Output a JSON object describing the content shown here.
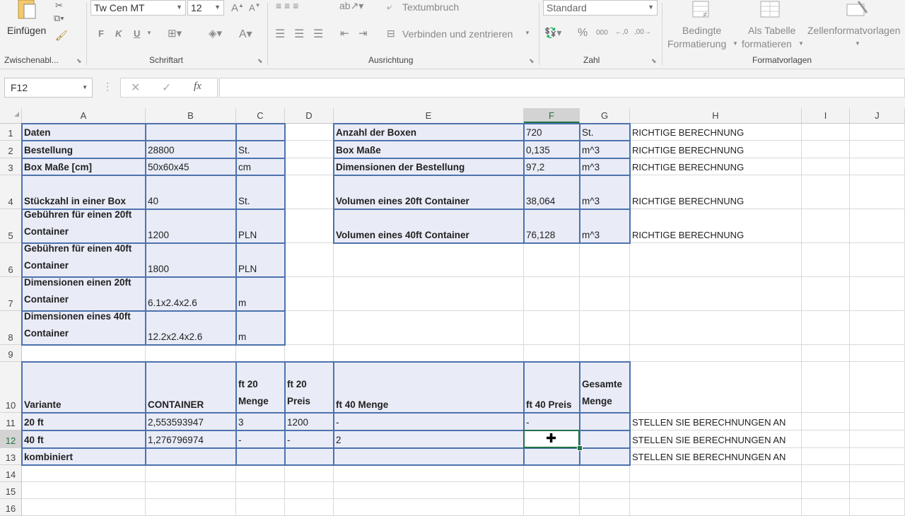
{
  "ribbon": {
    "paste_label": "Einfügen",
    "clipboard_label": "Zwischenabl...",
    "font_name": "Tw Cen MT",
    "font_size": "12",
    "bold": "F",
    "italic": "K",
    "underline": "U",
    "font_group_label": "Schriftart",
    "wrap_text": "Textumbruch",
    "merge_center": "Verbinden und zentrieren",
    "alignment_label": "Ausrichtung",
    "number_format": "Standard",
    "number_label": "Zahl",
    "cond_format_line1": "Bedingte",
    "cond_format_line2": "Formatierung",
    "as_table_line1": "Als Tabelle",
    "as_table_line2": "formatieren",
    "cell_styles": "Zellenformatvorlagen",
    "styles_label": "Formatvorlagen"
  },
  "formula_bar": {
    "name_box": "F12",
    "fx": "fx",
    "value": ""
  },
  "columns": [
    "A",
    "B",
    "C",
    "D",
    "E",
    "F",
    "G",
    "H",
    "I",
    "J"
  ],
  "selected_cell": "F12",
  "rows": [
    "1",
    "2",
    "3",
    "4",
    "5",
    "6",
    "7",
    "8",
    "9",
    "10",
    "11",
    "12",
    "13",
    "14",
    "15",
    "16"
  ],
  "cells": {
    "A1": "Daten",
    "A2": "Bestellung",
    "B2": "28800",
    "C2": "St.",
    "A3": "Box Maße [cm]",
    "B3": "50x60x45",
    "C3": "cm",
    "A4": "Stückzahl in einer Box",
    "B4": "40",
    "C4": "St.",
    "A5": "Gebühren für einen 20ft Container",
    "B5": "1200",
    "C5": "PLN",
    "A6": "Gebühren für einen 40ft Container",
    "B6": "1800",
    "C6": "PLN",
    "A7": "Dimensionen einen 20ft Container",
    "B7": "6.1x2.4x2.6",
    "C7": "m",
    "A8": "Dimensionen eines 40ft Container",
    "B8": "12.2x2.4x2.6",
    "C8": "m",
    "E1": "Anzahl der Boxen",
    "F1": "720",
    "G1": "St.",
    "H1": "RICHTIGE BERECHNUNG",
    "E2": "Box Maße",
    "F2": "0,135",
    "G2": "m^3",
    "H2": "RICHTIGE BERECHNUNG",
    "E3": "Dimensionen der Bestellung",
    "F3": "97,2",
    "G3": "m^3",
    "H3": "RICHTIGE BERECHNUNG",
    "E4": "Volumen eines 20ft Container",
    "F4": "38,064",
    "G4": "m^3",
    "H4": "RICHTIGE BERECHNUNG",
    "E5": "Volumen eines 40ft Container",
    "F5": "76,128",
    "G5": "m^3",
    "H5": "RICHTIGE BERECHNUNG",
    "A10": "Variante",
    "B10": "CONTAINER",
    "C10": "ft 20 Menge",
    "D10": "ft 20 Preis",
    "E10": "ft 40 Menge",
    "F10": "ft 40 Preis",
    "G10": "Gesamte Menge",
    "A11": "20 ft",
    "B11": "2,553593947",
    "C11": "3",
    "D11": "1200",
    "E11": "-",
    "F11": "-",
    "H11": "STELLEN SIE BERECHNUNGEN AN",
    "A12": "40 ft",
    "B12": "1,276796974",
    "C12": "-",
    "D12": "-",
    "E12": "2",
    "H12": "STELLEN SIE BERECHNUNGEN AN",
    "A13": "kombiniert",
    "H13": "STELLEN SIE BERECHNUNGEN AN"
  }
}
